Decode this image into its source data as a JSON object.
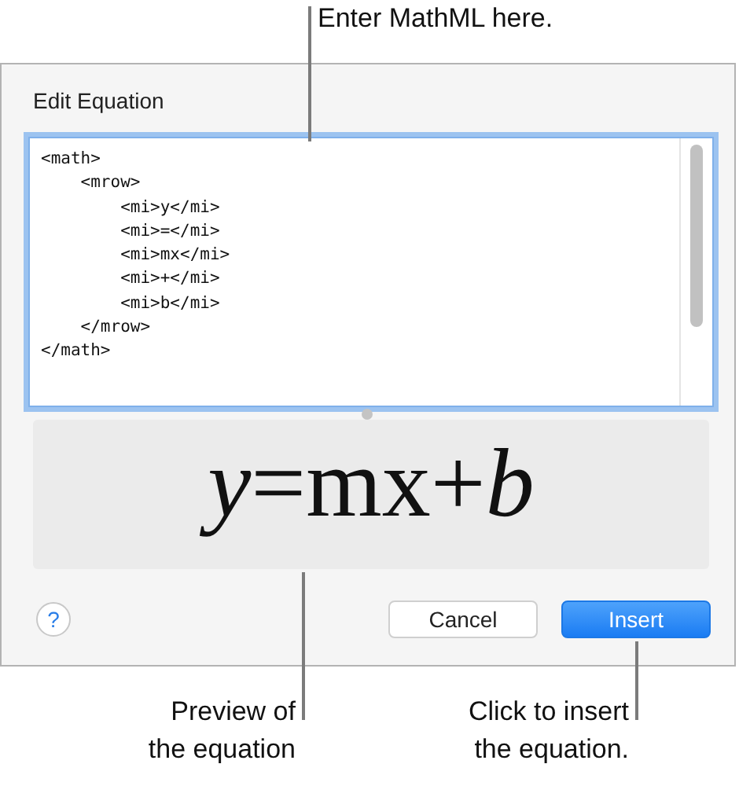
{
  "top_callout": {
    "text": "Enter MathML here."
  },
  "dialog": {
    "title": "Edit Equation",
    "editor": {
      "focused": true,
      "lines": [
        "<math>",
        "    <mrow>",
        "        <mi>y</mi>",
        "        <mi>=</mi>",
        "        <mi>mx</mi>",
        "        <mi>+</mi>",
        "        <mi>b</mi>",
        "    </mrow>",
        "</math>"
      ]
    },
    "preview": {
      "equation": "*y*=mx+*b*"
    },
    "help_button": {
      "label": "?"
    },
    "buttons": [
      {
        "label": "Cancel",
        "kind": "secondary"
      },
      {
        "label": "Insert",
        "kind": "primary"
      }
    ]
  },
  "bottom_callouts": [
    {
      "text": "Preview of\nthe equation"
    },
    {
      "text": "Click to insert\nthe equation."
    }
  ]
}
